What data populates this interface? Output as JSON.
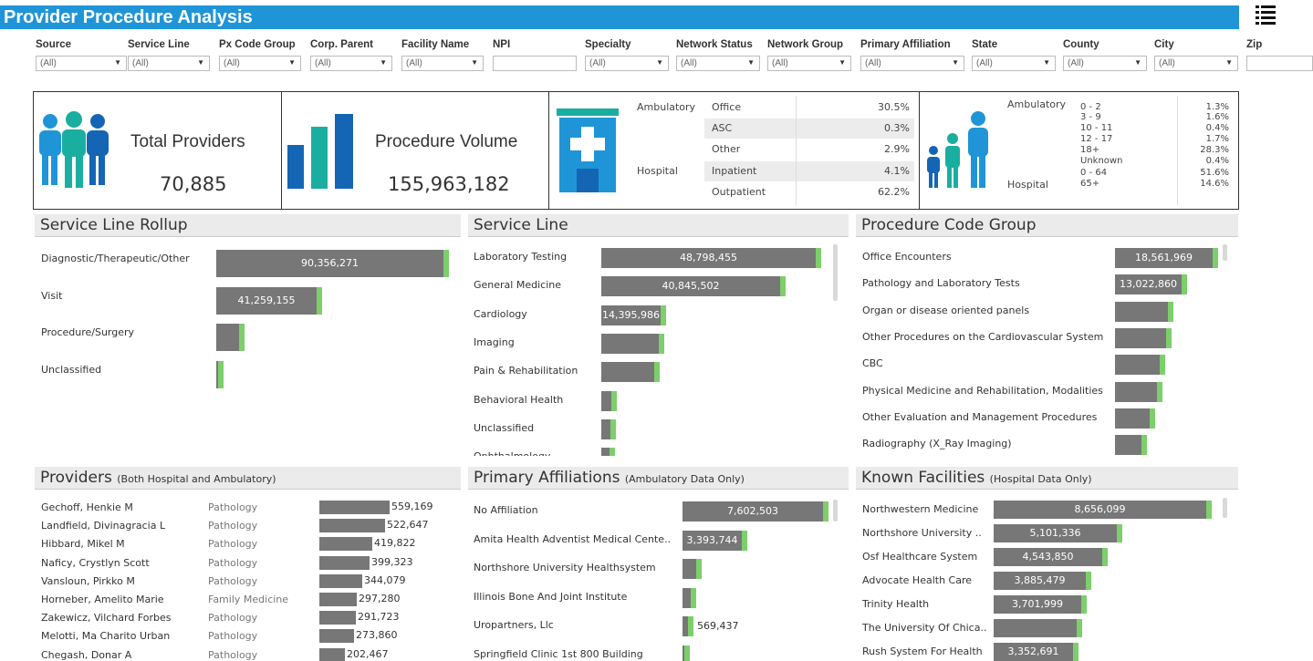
{
  "title": "Provider Procedure Analysis",
  "filters": [
    {
      "label": "Source",
      "value": "(All)"
    },
    {
      "label": "Service Line",
      "value": "(All)"
    },
    {
      "label": "Px Code Group",
      "value": "(All)"
    },
    {
      "label": "Corp. Parent",
      "value": "(All)"
    },
    {
      "label": "Facility Name",
      "value": "(All)"
    },
    {
      "label": "NPI",
      "value": ""
    },
    {
      "label": "Specialty",
      "value": "(All)"
    },
    {
      "label": "Network Status",
      "value": "(All)"
    },
    {
      "label": "Network Group",
      "value": "(All)"
    },
    {
      "label": "Primary Affiliation",
      "value": "(All)"
    },
    {
      "label": "State",
      "value": "(All)"
    },
    {
      "label": "County",
      "value": "(All)"
    },
    {
      "label": "City",
      "value": "(All)"
    },
    {
      "label": "Zip",
      "value": ""
    }
  ],
  "kpis": {
    "providers": {
      "label": "Total Providers",
      "value": "70,885"
    },
    "volume": {
      "label": "Procedure Volume",
      "value": "155,963,182"
    }
  },
  "setting_table": {
    "groups": [
      {
        "name": "Ambulatory",
        "rows": [
          {
            "label": "Office",
            "pct": "30.5%"
          },
          {
            "label": "ASC",
            "pct": "0.3%"
          },
          {
            "label": "Other",
            "pct": "2.9%"
          }
        ]
      },
      {
        "name": "Hospital",
        "rows": [
          {
            "label": "Inpatient",
            "pct": "4.1%"
          },
          {
            "label": "Outpatient",
            "pct": "62.2%"
          }
        ]
      }
    ]
  },
  "age_table": {
    "groups": [
      {
        "name": "Ambulatory",
        "rows": [
          {
            "label": "0 - 2",
            "pct": "1.3%"
          },
          {
            "label": "3 - 9",
            "pct": "1.6%"
          },
          {
            "label": "10 - 11",
            "pct": "0.4%"
          },
          {
            "label": "12 - 17",
            "pct": "1.7%"
          },
          {
            "label": "18+",
            "pct": "28.3%"
          },
          {
            "label": "Unknown",
            "pct": "0.4%"
          }
        ]
      },
      {
        "name": "Hospital",
        "rows": [
          {
            "label": "0 - 64",
            "pct": "51.6%"
          },
          {
            "label": "65+",
            "pct": "14.6%"
          }
        ]
      }
    ]
  },
  "panels": {
    "rollup": {
      "title": "Service Line Rollup",
      "rows": [
        {
          "label": "Diagnostic/Therapeutic/Other",
          "value": 90356271,
          "text": "90,356,271"
        },
        {
          "label": "Visit",
          "value": 41259155,
          "text": "41,259,155"
        },
        {
          "label": "Procedure/Surgery",
          "value": 11000000,
          "text": ""
        },
        {
          "label": "Unclassified",
          "value": 2000000,
          "text": ""
        }
      ]
    },
    "service_line": {
      "title": "Service Line",
      "rows": [
        {
          "label": "Laboratory Testing",
          "value": 48798455,
          "text": "48,798,455"
        },
        {
          "label": "General Medicine",
          "value": 40845502,
          "text": "40,845,502"
        },
        {
          "label": "Cardiology",
          "value": 14395986,
          "text": "14,395,986"
        },
        {
          "label": "Imaging",
          "value": 14000000,
          "text": ""
        },
        {
          "label": "Pain & Rehabilitation",
          "value": 13000000,
          "text": ""
        },
        {
          "label": "Behavioral Health",
          "value": 3500000,
          "text": ""
        },
        {
          "label": "Unclassified",
          "value": 3300000,
          "text": ""
        },
        {
          "label": "Ophthalmology",
          "value": 3000000,
          "text": ""
        }
      ]
    },
    "code_group": {
      "title": "Procedure Code Group",
      "rows": [
        {
          "label": "Office Encounters",
          "value": 18561969,
          "text": "18,561,969"
        },
        {
          "label": "Pathology and Laboratory Tests",
          "value": 13022860,
          "text": "13,022,860"
        },
        {
          "label": "Organ or disease oriented panels",
          "value": 10500000,
          "text": ""
        },
        {
          "label": "Other Procedures on the Cardiovascular System",
          "value": 10200000,
          "text": ""
        },
        {
          "label": "CBC",
          "value": 9000000,
          "text": ""
        },
        {
          "label": "Physical Medicine and Rehabilitation, Modalities",
          "value": 8500000,
          "text": ""
        },
        {
          "label": "Other Evaluation and Management Procedures",
          "value": 7300000,
          "text": ""
        },
        {
          "label": "Radiography (X_Ray Imaging)",
          "value": 5800000,
          "text": ""
        }
      ]
    },
    "providers": {
      "title": "Providers",
      "subtitle": "(Both Hospital and Ambulatory)",
      "rows": [
        {
          "name": "Gechoff, Henkie M",
          "specialty": "Pathology",
          "value": 559169,
          "text": "559,169"
        },
        {
          "name": "Landfield, Divinagracia L",
          "specialty": "Pathology",
          "value": 522647,
          "text": "522,647"
        },
        {
          "name": "Hibbard, Mikel M",
          "specialty": "Pathology",
          "value": 419822,
          "text": "419,822"
        },
        {
          "name": "Naficy, Crystlyn Scott",
          "specialty": "Pathology",
          "value": 399323,
          "text": "399,323"
        },
        {
          "name": "Vansloun, Pirkko M",
          "specialty": "Pathology",
          "value": 344079,
          "text": "344,079"
        },
        {
          "name": "Horneber, Amelito Marie",
          "specialty": "Family Medicine",
          "value": 297280,
          "text": "297,280"
        },
        {
          "name": "Zakewicz, Vilchard Forbes",
          "specialty": "Pathology",
          "value": 291723,
          "text": "291,723"
        },
        {
          "name": "Melotti, Ma Charito Urban",
          "specialty": "Pathology",
          "value": 273860,
          "text": "273,860"
        },
        {
          "name": "Chegash, Donar A",
          "specialty": "Pathology",
          "value": 202467,
          "text": "202,467"
        }
      ]
    },
    "affiliations": {
      "title": "Primary Affiliations",
      "subtitle": "(Ambulatory Data Only)",
      "rows": [
        {
          "label": "No Affiliation",
          "value": 7602503,
          "text": "7,602,503"
        },
        {
          "label": "Amita Health Adventist Medical Cente..",
          "value": 3393744,
          "text": "3,393,744"
        },
        {
          "label": "Northshore University Healthsystem",
          "value": 1000000,
          "text": ""
        },
        {
          "label": "Illinois Bone And Joint Institute",
          "value": 700000,
          "text": ""
        },
        {
          "label": "Uropartners, Llc",
          "value": 569437,
          "text": "569,437"
        },
        {
          "label": "Springfield Clinic 1st 800 Building",
          "value": 300000,
          "text": ""
        }
      ]
    },
    "facilities": {
      "title": "Known Facilities",
      "subtitle": "(Hospital Data Only)",
      "rows": [
        {
          "label": "Northwestern Medicine",
          "value": 8656099,
          "text": "8,656,099"
        },
        {
          "label": "Northshore University ..",
          "value": 5101336,
          "text": "5,101,336"
        },
        {
          "label": "Osf Healthcare System",
          "value": 4543850,
          "text": "4,543,850"
        },
        {
          "label": "Advocate Health Care",
          "value": 3885479,
          "text": "3,885,479"
        },
        {
          "label": "Trinity Health",
          "value": 3701999,
          "text": "3,701,999"
        },
        {
          "label": "The University Of Chica..",
          "value": 3500000,
          "text": ""
        },
        {
          "label": "Rush System For Health",
          "value": 3352691,
          "text": "3,352,691"
        }
      ]
    }
  },
  "colors": {
    "header": "#1f95d8",
    "bar": "#777777",
    "accent": "#7ccf6a",
    "icon_blue": "#1f95d8",
    "icon_teal": "#1aaea0",
    "icon_navy": "#1565b5"
  }
}
